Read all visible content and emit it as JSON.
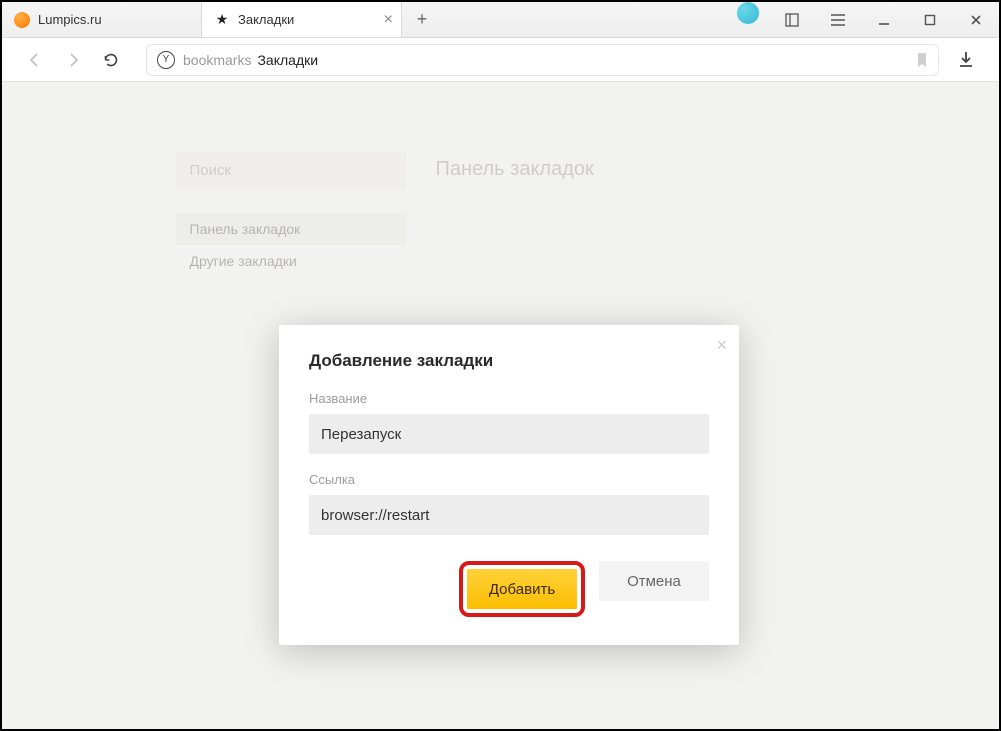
{
  "tabs": [
    {
      "label": "Lumpics.ru",
      "favicon": "orange",
      "closeable": false
    },
    {
      "label": "Закладки",
      "favicon": "star",
      "active": true,
      "closeable": true
    }
  ],
  "addressbar": {
    "prefix": "bookmarks",
    "title": "Закладки"
  },
  "bookmarks": {
    "search_placeholder": "Поиск",
    "heading": "Панель закладок",
    "nav": [
      {
        "label": "Панель закладок",
        "active": true
      },
      {
        "label": "Другие закладки",
        "active": false
      }
    ]
  },
  "dialog": {
    "title": "Добавление закладки",
    "name_label": "Название",
    "name_value": "Перезапуск",
    "url_label": "Ссылка",
    "url_value": "browser://restart",
    "add_button": "Добавить",
    "cancel_button": "Отмена"
  }
}
